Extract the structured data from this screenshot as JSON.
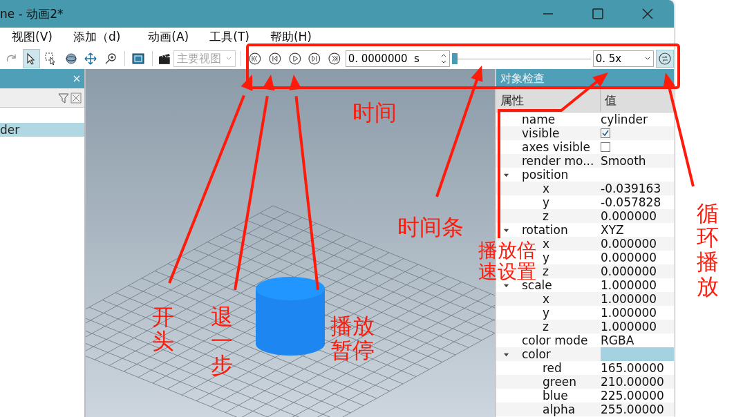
{
  "window": {
    "title": "ne - 动画2*"
  },
  "menu": [
    {
      "label": "视图(V)"
    },
    {
      "label": "添加（d)"
    },
    {
      "label": "动画(A)"
    },
    {
      "label": "工具(T)"
    },
    {
      "label": "帮助(H)"
    }
  ],
  "tools": [
    {
      "kind": "redo",
      "selected": false
    },
    {
      "kind": "select",
      "selected": true
    },
    {
      "kind": "box-select",
      "selected": false
    },
    {
      "kind": "orbit",
      "selected": false
    },
    {
      "kind": "move",
      "selected": false
    },
    {
      "kind": "zoom",
      "selected": false
    },
    {
      "kind": "fit",
      "selected": false
    }
  ],
  "view_combo": {
    "value": "主要视图",
    "disabled": true
  },
  "playback": {
    "buttons": [
      {
        "kind": "first"
      },
      {
        "kind": "step-back"
      },
      {
        "kind": "play"
      },
      {
        "kind": "step-forward"
      },
      {
        "kind": "last"
      }
    ],
    "time": "0. 0000000  s",
    "level": 0,
    "speed": "0. 5x",
    "loop": true
  },
  "scene_panel": {
    "items": [
      {
        "label": "der",
        "selected": true
      }
    ]
  },
  "inspector": {
    "title": "对象检查",
    "columns": [
      "属性",
      "值"
    ],
    "properties": [
      {
        "name": "name",
        "kind": "text",
        "value": "cylinder"
      },
      {
        "name": "visible",
        "kind": "checkbox",
        "checked": true
      },
      {
        "name": "axes visible",
        "kind": "checkbox",
        "checked": false
      },
      {
        "name": "render mo...",
        "kind": "text",
        "value": "Smooth"
      },
      {
        "name": "position",
        "kind": "group",
        "expanded": true,
        "children": [
          {
            "name": "x",
            "kind": "text",
            "value": "-0.039163"
          },
          {
            "name": "y",
            "kind": "text",
            "value": "-0.057828"
          },
          {
            "name": "z",
            "kind": "text",
            "value": "0.000000"
          }
        ]
      },
      {
        "name": "rotation",
        "kind": "group",
        "value": "XYZ",
        "expanded": true,
        "children": [
          {
            "name": "x",
            "kind": "text",
            "value": "0.000000"
          },
          {
            "name": "y",
            "kind": "text",
            "value": "0.000000"
          },
          {
            "name": "z",
            "kind": "text",
            "value": "0.000000"
          }
        ]
      },
      {
        "name": "scale",
        "kind": "group",
        "value": "1.000000",
        "expanded": true,
        "children": [
          {
            "name": "x",
            "kind": "text",
            "value": "1.000000"
          },
          {
            "name": "y",
            "kind": "text",
            "value": "1.000000"
          },
          {
            "name": "z",
            "kind": "text",
            "value": "1.000000"
          }
        ]
      },
      {
        "name": "color mode",
        "kind": "text",
        "value": "RGBA"
      },
      {
        "name": "color",
        "kind": "color",
        "color": "#a5d2e1",
        "expanded": true,
        "children": [
          {
            "name": "red",
            "kind": "text",
            "value": "165.00000"
          },
          {
            "name": "green",
            "kind": "text",
            "value": "210.00000"
          },
          {
            "name": "blue",
            "kind": "text",
            "value": "225.00000"
          },
          {
            "name": "alpha",
            "kind": "text",
            "value": "255.00000"
          }
        ]
      }
    ]
  },
  "annotations": [
    {
      "text": "时间"
    },
    {
      "text": "时间条"
    },
    {
      "text": "播放倍速设置"
    },
    {
      "text": "循环播放"
    },
    {
      "text": "开头"
    },
    {
      "text": "退一步"
    },
    {
      "text": "播放暂停"
    }
  ]
}
